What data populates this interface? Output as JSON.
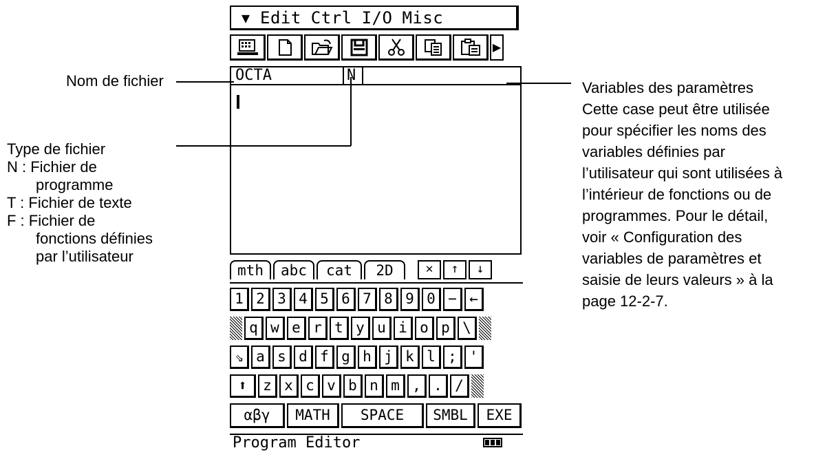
{
  "menu": {
    "chevron": "▼",
    "items": [
      "Edit",
      "Ctrl",
      "I/O",
      "Misc"
    ]
  },
  "toolbar": {
    "icons": [
      "calculator-icon",
      "new-file-icon",
      "open-folder-icon",
      "save-icon",
      "cut-icon",
      "copy-icon",
      "paste-icon"
    ],
    "more": "▶"
  },
  "editor": {
    "file_name": "OCTA",
    "file_type": "N",
    "parameters": ""
  },
  "keyboard_tabs": [
    "mth",
    "abc",
    "cat",
    "2D"
  ],
  "keyboard_tab_icons": [
    "close-icon",
    "up-arrow-icon",
    "down-arrow-icon"
  ],
  "keyboard": {
    "row1": [
      "1",
      "2",
      "3",
      "4",
      "5",
      "6",
      "7",
      "8",
      "9",
      "0",
      "−",
      "←"
    ],
    "row2": [
      "q",
      "w",
      "e",
      "r",
      "t",
      "y",
      "u",
      "i",
      "o",
      "p",
      "\\"
    ],
    "row3": [
      "⇘",
      "a",
      "s",
      "d",
      "f",
      "g",
      "h",
      "j",
      "k",
      "l",
      ";",
      "'"
    ],
    "row4": [
      "⬆",
      "z",
      "x",
      "c",
      "v",
      "b",
      "n",
      "m",
      ",",
      ".",
      "/"
    ],
    "bottom": [
      "αβγ",
      "MATH",
      "SPACE",
      "SMBL",
      "EXE"
    ]
  },
  "status": {
    "app_name": "Program Editor"
  },
  "annotations": {
    "file_name": "Nom de fichier",
    "file_type": {
      "title": "Type de fichier",
      "n": "N : Fichier de",
      "n2": "programme",
      "t": "T :  Fichier de texte",
      "f": "F :  Fichier de",
      "f2": "fonctions définies",
      "f3": "par l’utilisateur"
    },
    "params": {
      "l1": "Variables des paramètres",
      "l2": "Cette case peut être utilisée",
      "l3": "pour spécifier les noms des",
      "l4": "variables définies par",
      "l5": "l’utilisateur qui sont utilisées à",
      "l6": "l’intérieur de fonctions ou de",
      "l7": "programmes. Pour le détail,",
      "l8": "voir « Configuration des",
      "l9": "variables de paramètres et",
      "l10": "saisie de leurs valeurs » à la",
      "l11": "page 12-2-7."
    }
  }
}
